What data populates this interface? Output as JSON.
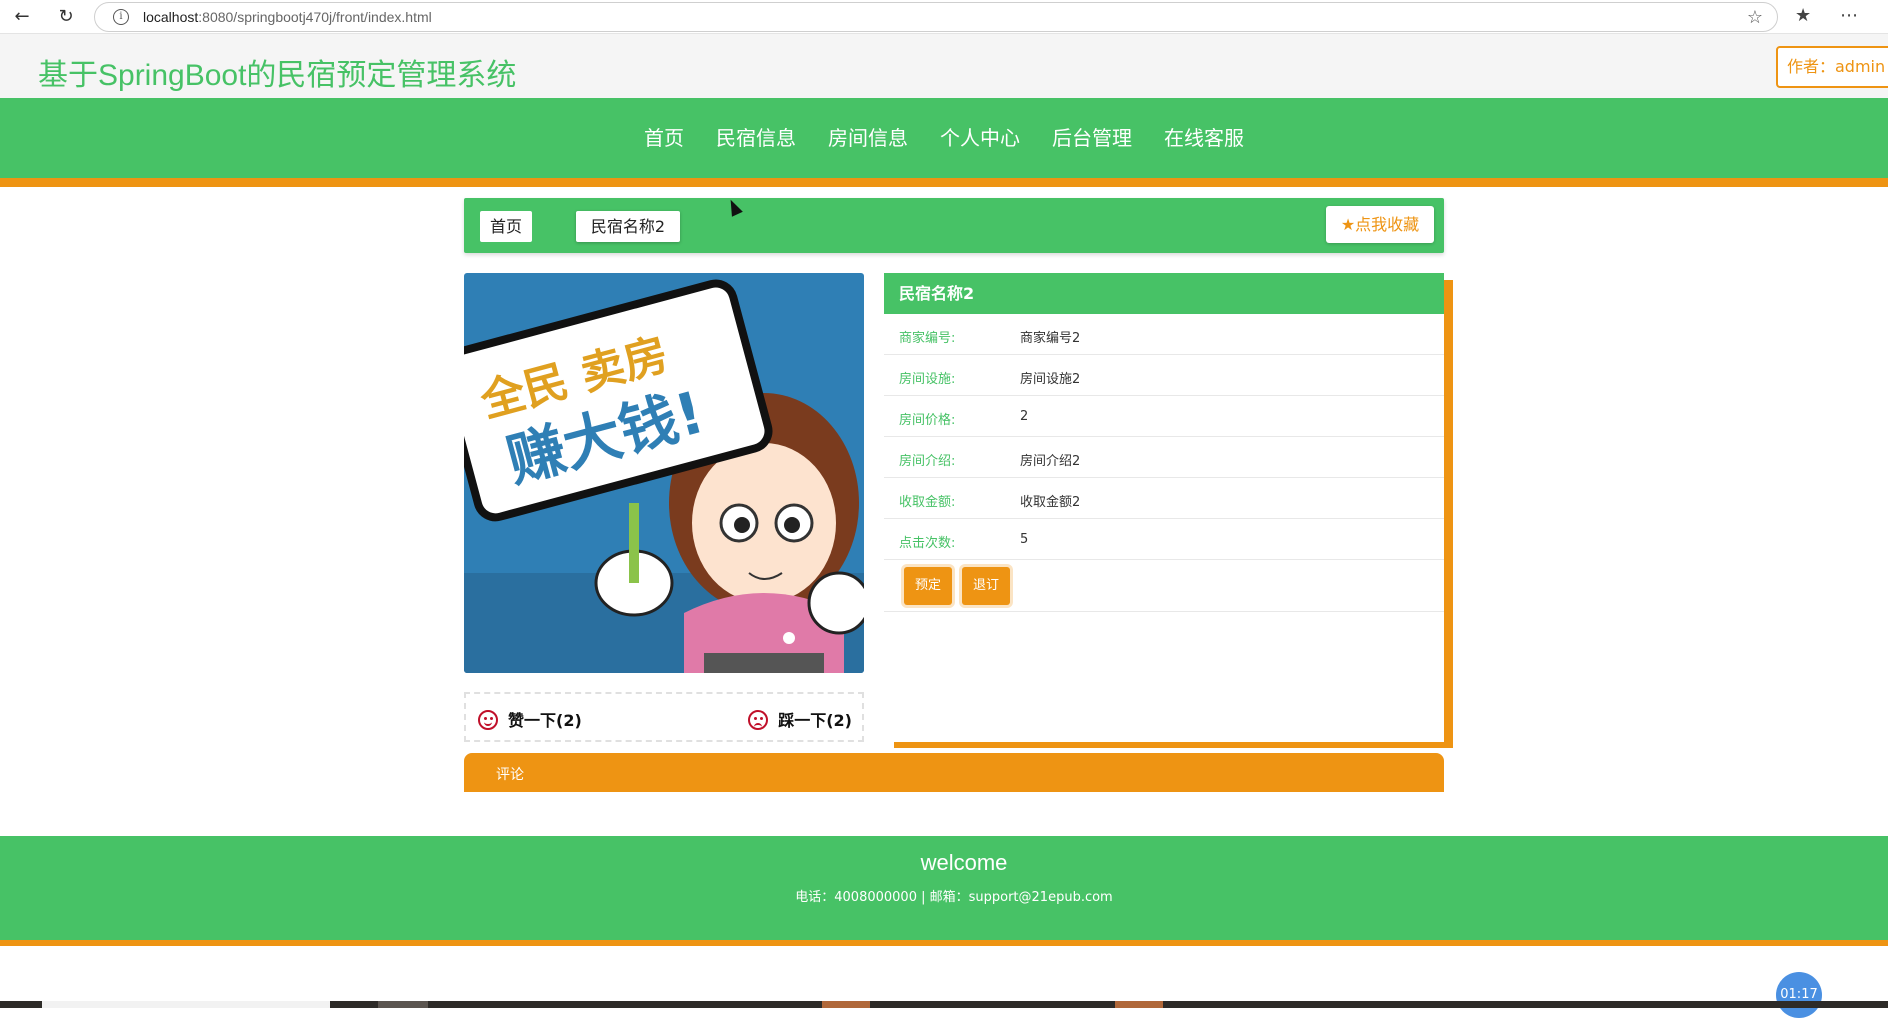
{
  "browser": {
    "url_host": "localhost",
    "url_rest": ":8080/springbootj470j/front/index.html"
  },
  "header": {
    "site_title": "基于SpringBoot的民宿预定管理系统",
    "author_label": "作者：admin"
  },
  "nav": {
    "items": [
      {
        "label": "首页"
      },
      {
        "label": "民宿信息"
      },
      {
        "label": "房间信息"
      },
      {
        "label": "个人中心"
      },
      {
        "label": "后台管理"
      },
      {
        "label": "在线客服"
      }
    ]
  },
  "breadcrumb": {
    "home": "首页",
    "current": "民宿名称2",
    "favorite_label": "点我收藏"
  },
  "votes": {
    "like_label": "赞一下(2)",
    "dislike_label": "踩一下(2)"
  },
  "detail": {
    "title": "民宿名称2",
    "fields": [
      {
        "label": "商家编号:",
        "value": "商家编号2"
      },
      {
        "label": "房间设施:",
        "value": "房间设施2"
      },
      {
        "label": "房间价格:",
        "value": "2"
      },
      {
        "label": "房间介绍:",
        "value": "房间介绍2"
      },
      {
        "label": "收取金额:",
        "value": "收取金额2"
      },
      {
        "label": "点击次数:",
        "value": "5"
      }
    ],
    "book_label": "预定",
    "cancel_label": "退订"
  },
  "comments": {
    "label": "评论"
  },
  "image": {
    "sign_line1": "全民 卖房",
    "sign_line2": "赚大钱!"
  },
  "footer": {
    "title": "welcome",
    "contact": "电话：4008000000 | 邮箱：support@21epub.com"
  },
  "timer": "01:17",
  "colors": {
    "primary_green": "#47c266",
    "accent_orange": "#ee9413"
  }
}
